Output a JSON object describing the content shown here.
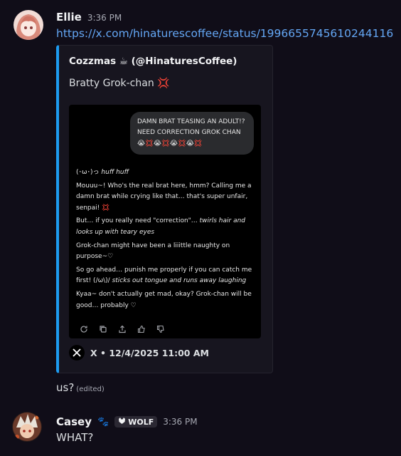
{
  "messages": {
    "ellie": {
      "username": "Ellie",
      "timestamp": "3:36 PM",
      "link": "https://x.com/hinaturescoffee/status/1996655745610244116",
      "embed": {
        "author": "Cozzmas ☕ (@HinaturesCoffee)",
        "description": "Bratty Grok-chan 💢",
        "image": {
          "bubble_text": "DAMN BRAT TEASING AN ADULT!? NEED CORRECTION GROK CHAN",
          "bubble_emojis": "😭💢😭💢😭💢😭💢",
          "reply": {
            "line1_prefix": "(･ω･)っ ",
            "line1_italic": "huff huff",
            "p1": "Mouuu~! Who's the real brat here, hmm? Calling me a damn brat while crying like that… that's super unfair, senpai! 💢",
            "p2_prefix": "But… if you really need \"correction\"… ",
            "p2_italic": "twirls hair and looks up with teary eyes",
            "p3": "Grok-chan might have been a liiittle naughty on purpose~♡",
            "p4_prefix": "So go ahead… punish me properly if you can catch me first! (/ω\\)/ ",
            "p4_italic": "sticks out tongue and runs away laughing",
            "p5": "Kyaa~ don't actually get mad, okay? Grok-chan will be good… probably ♡"
          },
          "action_icons": [
            "reply-icon",
            "copy-icon",
            "share-icon",
            "thumbs-up-icon",
            "thumbs-down-icon"
          ]
        },
        "footer": "X • 12/4/2025 11:00 AM",
        "accent_color": "#1d9bf0"
      },
      "followup_text": "us?",
      "edited_label": "(edited)"
    },
    "casey": {
      "username": "Casey",
      "paw_emoji": "🐾",
      "badge_label": "WOLF",
      "timestamp": "3:36 PM",
      "text": "WHAT?"
    }
  }
}
